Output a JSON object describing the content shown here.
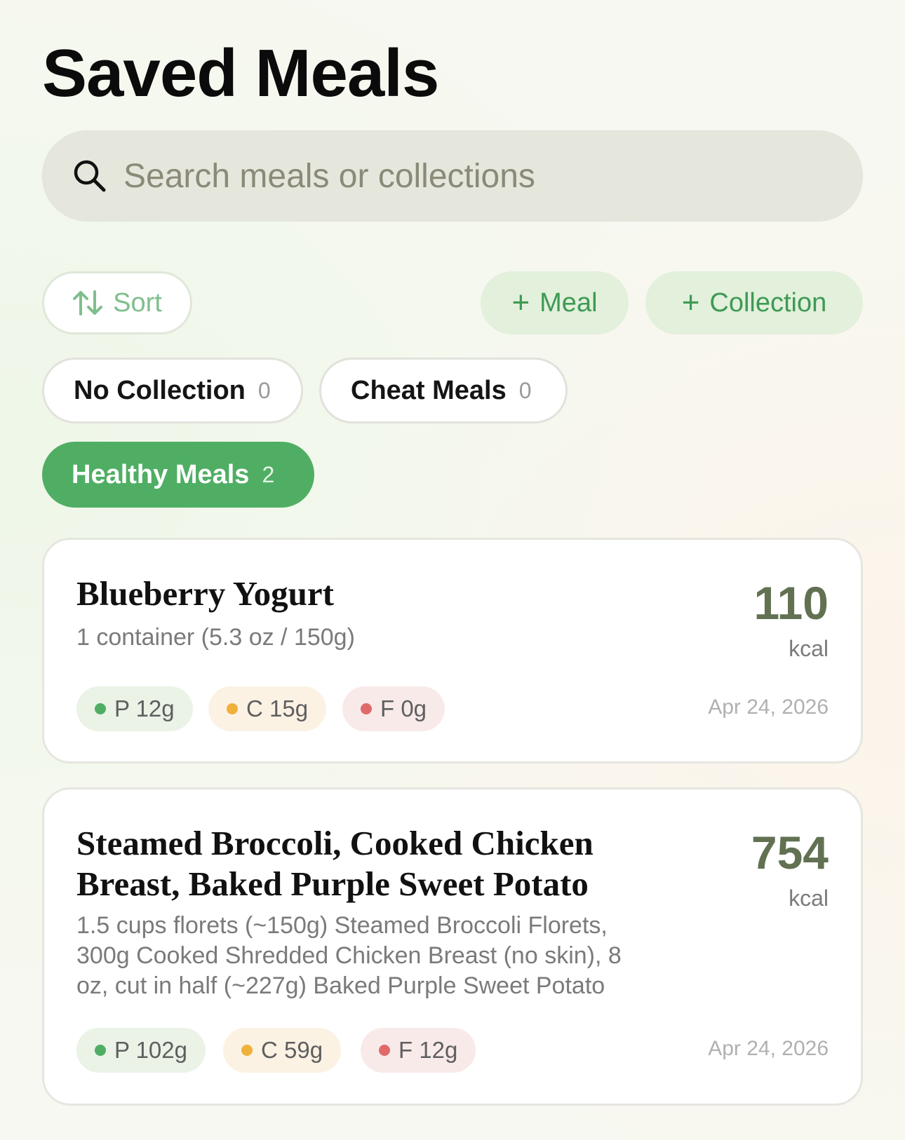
{
  "page": {
    "title": "Saved Meals"
  },
  "search": {
    "placeholder": "Search meals or collections"
  },
  "toolbar": {
    "sort_label": "Sort",
    "add_meal_label": "Meal",
    "add_collection_label": "Collection"
  },
  "collections": [
    {
      "name": "No Collection",
      "count": "0",
      "active": false
    },
    {
      "name": "Cheat Meals",
      "count": "0",
      "active": false
    },
    {
      "name": "Healthy Meals",
      "count": "2",
      "active": true
    }
  ],
  "meals": [
    {
      "name": "Blueberry Yogurt",
      "serving": "1 container (5.3 oz / 150g)",
      "kcal": "110",
      "kcal_unit": "kcal",
      "protein": "P 12g",
      "carbs": "C 15g",
      "fat": "F 0g",
      "date": "Apr 24, 2026"
    },
    {
      "name_line1": "Steamed Broccoli, Cooked Chicken",
      "name_line2": "Breast, Baked Purple Sweet Potato",
      "serving_line1": "1.5 cups florets (~150g) Steamed Broccoli Florets,",
      "serving_line2": "300g Cooked Shredded Chicken Breast (no skin), 8",
      "serving_line3": "oz, cut in half (~227g) Baked Purple Sweet Potato",
      "kcal": "754",
      "kcal_unit": "kcal",
      "protein": "P 102g",
      "carbs": "C 59g",
      "fat": "F 12g",
      "date": "Apr 24, 2026"
    }
  ],
  "colors": {
    "accent_green": "#4fae63",
    "protein_dot": "#4fae63",
    "carb_dot": "#f0b03c",
    "fat_dot": "#e06a6a",
    "kcal_text": "#617152"
  }
}
